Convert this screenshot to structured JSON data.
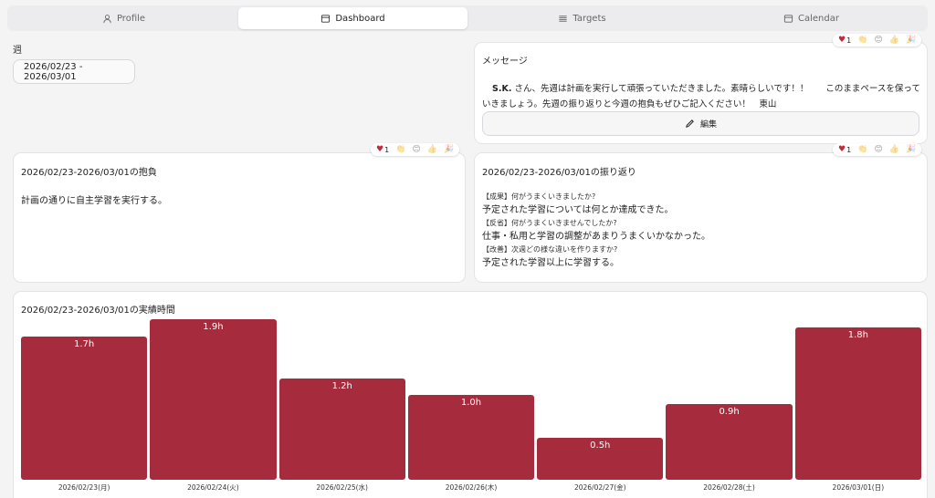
{
  "tabs": [
    {
      "label": "Profile",
      "icon": "user-icon",
      "active": false
    },
    {
      "label": "Dashboard",
      "icon": "dashboard-icon",
      "active": true
    },
    {
      "label": "Targets",
      "icon": "list-icon",
      "active": false
    },
    {
      "label": "Calendar",
      "icon": "calendar-icon",
      "active": false
    }
  ],
  "week": {
    "label": "週",
    "value": "2026/02/23 - 2026/03/01"
  },
  "message": {
    "title": "メッセージ",
    "line1_bold": "S.K.",
    "line1_rest": " さん、先週は計画を実行して頑張っていただきました。素晴らしいです！！　　このままペースを保って",
    "line2": "いきましょう。先週の振り返りと今週の抱負もぜひご記入ください！　東山",
    "edit_label": "編集",
    "heart_count": "1"
  },
  "goal": {
    "title": "2026/02/23-2026/03/01の抱負",
    "text": "計画の通りに自主学習を実行する。",
    "heart_count": "1"
  },
  "reflection": {
    "title": "2026/02/23-2026/03/01の振り返り",
    "q1": "【成果】何がうまくいきましたか?",
    "a1": "予定された学習については何とか達成できた。",
    "q2": "【反省】何がうまくいきませんでしたか?",
    "a2": "仕事・私用と学習の調整があまりうまくいかなかった。",
    "q3": "【改善】次週どの様な違いを作りますか?",
    "a3": "予定された学習以上に学習する。",
    "heart_count": "1"
  },
  "performance": {
    "title": "2026/02/23-2026/03/01の実績時間"
  },
  "colors": {
    "bar": "#a62b3c",
    "heart": "#c22a3a"
  },
  "chart_data": {
    "type": "bar",
    "categories": [
      "2026/02/23(月)",
      "2026/02/24(火)",
      "2026/02/25(水)",
      "2026/02/26(木)",
      "2026/02/27(金)",
      "2026/02/28(土)",
      "2026/03/01(日)"
    ],
    "values": [
      1.7,
      1.9,
      1.2,
      1.0,
      0.5,
      0.9,
      1.8
    ],
    "labels": [
      "1.7h",
      "1.9h",
      "1.2h",
      "1.0h",
      "0.5h",
      "0.9h",
      "1.8h"
    ],
    "title": "2026/02/23-2026/03/01の実績時間",
    "ylim": [
      0,
      1.9
    ]
  }
}
